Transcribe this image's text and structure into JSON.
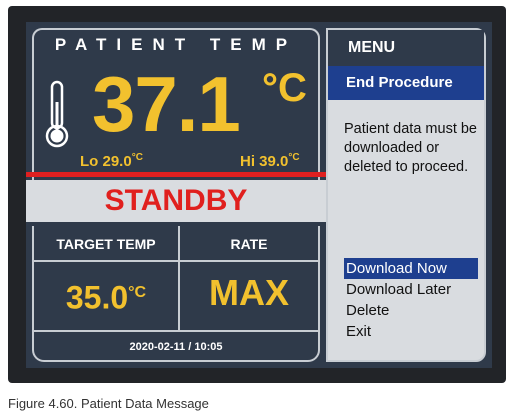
{
  "panel": {
    "title": "PATIENT TEMP",
    "temperature": "37.1",
    "unit": "°C",
    "lo_label": "Lo",
    "lo_value": "29.0",
    "hi_label": "Hi",
    "hi_value": "39.0",
    "small_unit": "°C",
    "status": "STANDBY",
    "target_label": "TARGET TEMP",
    "target_value": "35.0",
    "rate_label": "RATE",
    "rate_value": "MAX",
    "datetime": "2020-02-11 / 10:05"
  },
  "menu": {
    "title": "MENU",
    "selected": "End Procedure",
    "message": "Patient data must be downloaded or deleted to proceed.",
    "options": [
      "Download Now",
      "Download Later",
      "Delete",
      "Exit"
    ],
    "active_index": 0
  },
  "caption": "Figure 4.60. Patient Data Message",
  "colors": {
    "screen_bg": "#2f3a4a",
    "accent_yellow": "#f2c12e",
    "status_red": "#e0201e",
    "selection_blue": "#1e3f8f",
    "light_panel": "#d9dce0"
  }
}
